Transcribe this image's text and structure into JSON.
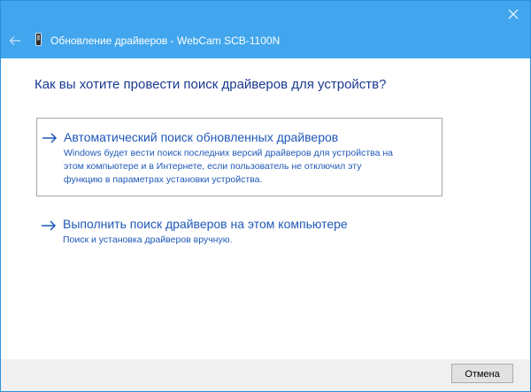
{
  "window": {
    "title": "Обновление драйверов - WebCam SCB-1100N"
  },
  "icons": {
    "close": "close-icon",
    "back": "back-arrow-icon",
    "device": "device-icon",
    "option_arrow": "right-arrow-icon"
  },
  "question": "Как вы хотите провести поиск драйверов для устройств?",
  "options": [
    {
      "title": "Автоматический поиск обновленных драйверов",
      "description_lines": [
        "Windows будет вести поиск последних версий драйверов для устройства на",
        "этом компьютере и в Интернете, если пользователь не отключил эту",
        "функцию в параметрах установки устройства."
      ]
    },
    {
      "title": "Выполнить поиск драйверов на этом компьютере",
      "description_lines": [
        "Поиск и установка драйверов вручную."
      ]
    }
  ],
  "footer": {
    "cancel_label": "Отмена"
  },
  "colors": {
    "top_bar": "#41a6ed",
    "link_blue": "#1f58b8",
    "question_blue": "#1a3a8f",
    "footer_bg": "#f0f0f0"
  }
}
